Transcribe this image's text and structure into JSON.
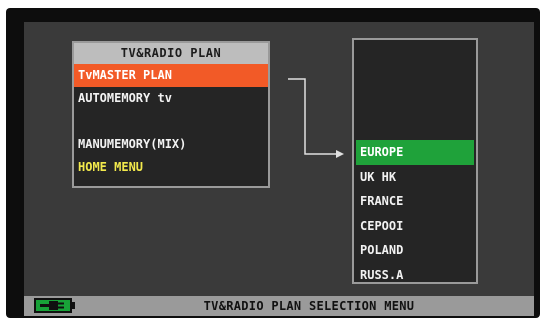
{
  "menu": {
    "title": "TV&RADIO PLAN",
    "items": [
      {
        "label": "TvMASTER PLAN",
        "state": "selected"
      },
      {
        "label": "AUTOMEMORY tv",
        "state": "normal"
      },
      {
        "label": "",
        "state": "normal"
      },
      {
        "label": "MANUMEMORY(MIX)",
        "state": "normal"
      },
      {
        "label": "HOME MENU",
        "state": "highlight-yellow"
      }
    ]
  },
  "plan_list": {
    "items": [
      {
        "label": "EUROPE",
        "active": true
      },
      {
        "label": "UK HK",
        "active": false
      },
      {
        "label": "FRANCE",
        "active": false
      },
      {
        "label": "CEPOOI",
        "active": false
      },
      {
        "label": "POLAND",
        "active": false
      },
      {
        "label": "RUSS.A",
        "active": false
      }
    ]
  },
  "status_bar": {
    "text": "TV&RADIO PLAN SELECTION MENU",
    "battery_icon": "battery-plug-icon"
  },
  "colors": {
    "selection_orange": "#f25a27",
    "active_green": "#1fa23a",
    "yellow_text": "#f2e94c",
    "screen_bg": "#3a3a3a"
  }
}
